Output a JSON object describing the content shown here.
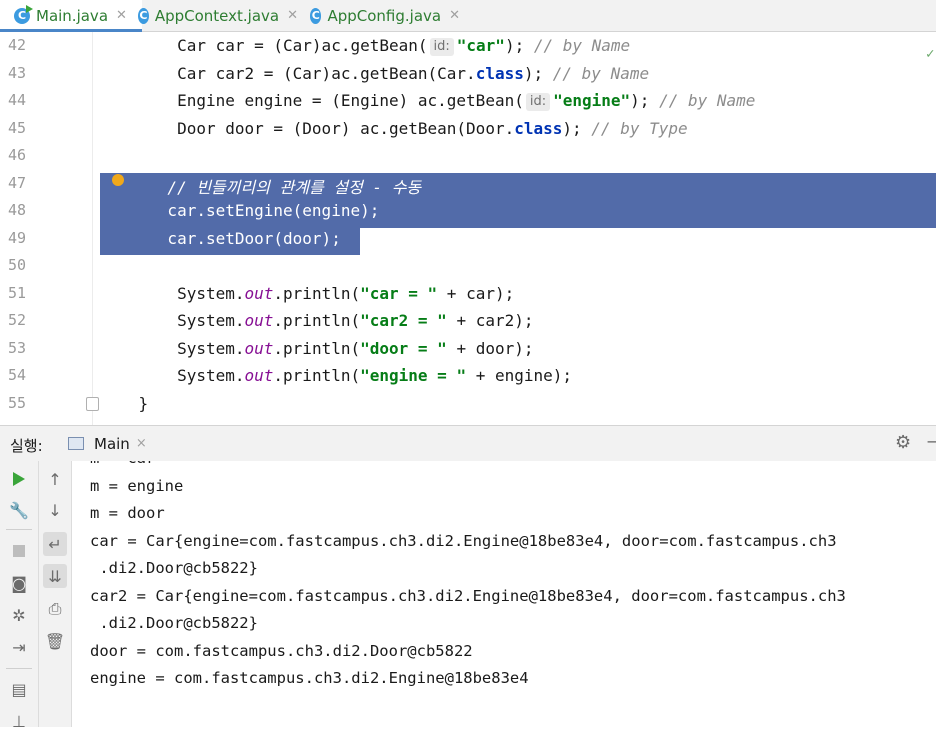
{
  "tabs": [
    {
      "label": "Main.java",
      "icon": "class-run-icon",
      "active": true
    },
    {
      "label": "AppContext.java",
      "icon": "class-icon",
      "active": false
    },
    {
      "label": "AppConfig.java",
      "icon": "class-icon",
      "active": false
    }
  ],
  "editor": {
    "lines": [
      {
        "num": "42",
        "code": [
          {
            "t": "        Car car = (Car)ac.getBean("
          },
          {
            "t": "id:",
            "c": "hint"
          },
          {
            "t": "\"car\"",
            "c": "str"
          },
          {
            "t": "); "
          },
          {
            "t": "// by Name",
            "c": "cmt"
          }
        ]
      },
      {
        "num": "43",
        "code": [
          {
            "t": "        Car car2 = (Car)ac.getBean(Car."
          },
          {
            "t": "class",
            "c": "kw"
          },
          {
            "t": "); "
          },
          {
            "t": "// by Name",
            "c": "cmt"
          }
        ]
      },
      {
        "num": "44",
        "code": [
          {
            "t": "        Engine engine = (Engine) ac.getBean("
          },
          {
            "t": "id:",
            "c": "hint"
          },
          {
            "t": "\"engine\"",
            "c": "str"
          },
          {
            "t": "); "
          },
          {
            "t": "// by Name",
            "c": "cmt"
          }
        ]
      },
      {
        "num": "45",
        "code": [
          {
            "t": "        Door door = (Door) ac.getBean(Door."
          },
          {
            "t": "class",
            "c": "kw"
          },
          {
            "t": "); "
          },
          {
            "t": "// by Type",
            "c": "cmt"
          }
        ]
      },
      {
        "num": "46",
        "code": []
      },
      {
        "num": "47",
        "code": [
          {
            "t": "       // 빈들끼리의 관계를 설정 - 수동",
            "c": "cmt"
          }
        ]
      },
      {
        "num": "48",
        "code": [
          {
            "t": "       car.setEngine(engine);"
          }
        ]
      },
      {
        "num": "49",
        "code": [
          {
            "t": "       car.setDoor(door);"
          }
        ]
      },
      {
        "num": "50",
        "code": []
      },
      {
        "num": "51",
        "code": [
          {
            "t": "        System."
          },
          {
            "t": "out",
            "c": "fld"
          },
          {
            "t": ".println("
          },
          {
            "t": "\"car = \"",
            "c": "str"
          },
          {
            "t": " + car);"
          }
        ]
      },
      {
        "num": "52",
        "code": [
          {
            "t": "        System."
          },
          {
            "t": "out",
            "c": "fld"
          },
          {
            "t": ".println("
          },
          {
            "t": "\"car2 = \"",
            "c": "str"
          },
          {
            "t": " + car2);"
          }
        ]
      },
      {
        "num": "53",
        "code": [
          {
            "t": "        System."
          },
          {
            "t": "out",
            "c": "fld"
          },
          {
            "t": ".println("
          },
          {
            "t": "\"door = \"",
            "c": "str"
          },
          {
            "t": " + door);"
          }
        ]
      },
      {
        "num": "54",
        "code": [
          {
            "t": "        System."
          },
          {
            "t": "out",
            "c": "fld"
          },
          {
            "t": ".println("
          },
          {
            "t": "\"engine = \"",
            "c": "str"
          },
          {
            "t": " + engine);"
          }
        ]
      },
      {
        "num": "55",
        "code": [
          {
            "t": "    }"
          }
        ]
      }
    ]
  },
  "run_panel": {
    "label": "실행:",
    "tab_label": "Main",
    "tab_close": "×"
  },
  "console": {
    "lines": [
      "m = car",
      "m = engine",
      "m = door",
      "car = Car{engine=com.fastcampus.ch3.di2.Engine@18be83e4, door=com.fastcampus.ch3",
      " .di2.Door@cb5822}",
      "car2 = Car{engine=com.fastcampus.ch3.di2.Engine@18be83e4, door=com.fastcampus.ch3",
      " .di2.Door@cb5822}",
      "door = com.fastcampus.ch3.di2.Door@cb5822",
      "engine = com.fastcampus.ch3.di2.Engine@18be83e4"
    ]
  },
  "colors": {
    "selection": "#526ba9",
    "string": "#067d17",
    "keyword": "#0033b3",
    "comment": "#8c8c8c",
    "tab_text": "#2e7d32"
  }
}
